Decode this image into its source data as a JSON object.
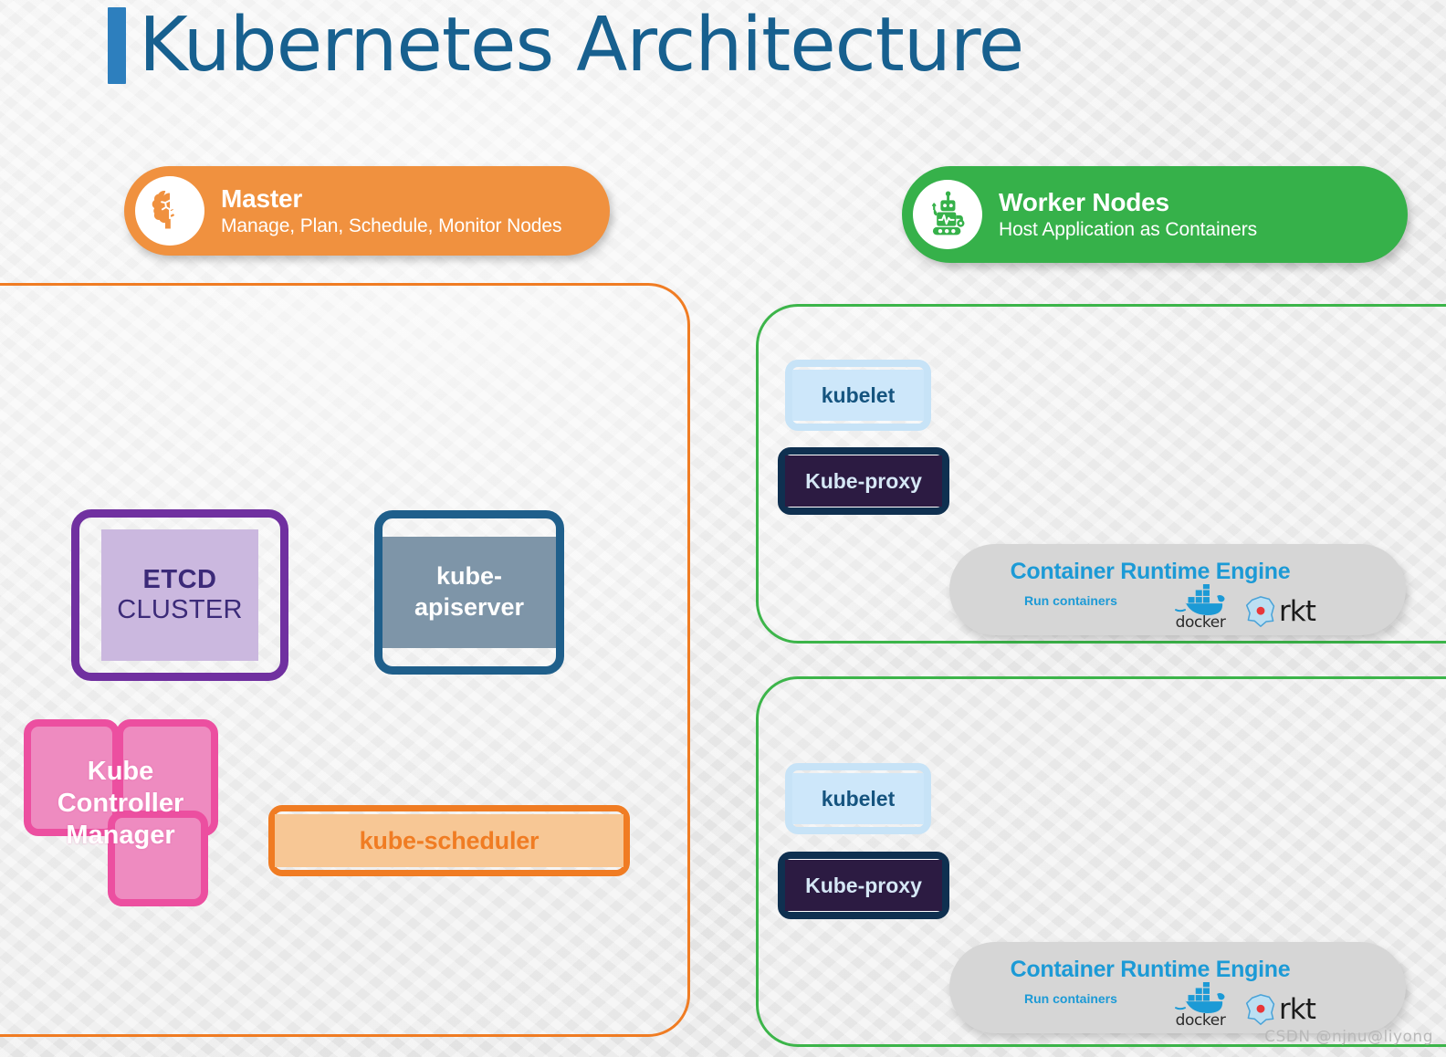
{
  "title": {
    "text": "Kubernetes Architecture",
    "accent_color": "#2d7fbe",
    "text_color": "#17608f"
  },
  "master": {
    "pill": {
      "title": "Master",
      "subtitle": "Manage, Plan, Schedule, Monitor Nodes",
      "icon": "brain-icon",
      "color": "#f0913f"
    },
    "panel_border_color": "#f07c23",
    "components": {
      "etcd": {
        "title": "ETCD",
        "subtitle": "CLUSTER",
        "border_color": "#7030a0",
        "fill_color": "#cbb8df",
        "text_color": "#3b2a78"
      },
      "apiserver": {
        "line1": "kube-",
        "line2": "apiserver",
        "border_color": "#1f5f8b",
        "fill_color": "#7e95a8",
        "text_color": "#ffffff"
      },
      "controller_manager": {
        "label": "Kube Controller Manager",
        "line1": "Kube",
        "line2": "Controller",
        "line3": "Manager",
        "border_color": "#ec4fa0",
        "fill_color": "#ee8bc0",
        "text_color": "#ffffff"
      },
      "scheduler": {
        "label": "kube-scheduler",
        "border_color": "#f07c23",
        "fill_color": "#f7c795",
        "text_color": "#f07c23"
      }
    }
  },
  "worker": {
    "pill": {
      "title": "Worker Nodes",
      "subtitle": "Host Application as Containers",
      "icon": "robot-icon",
      "color": "#36b14a"
    },
    "panel_border_color": "#3cb54a",
    "nodes": [
      {
        "kubelet": "kubelet",
        "kube_proxy": "Kube-proxy",
        "runtime": {
          "title": "Container Runtime Engine",
          "subtitle": "Run containers",
          "logos": [
            "docker",
            "rkt"
          ]
        }
      },
      {
        "kubelet": "kubelet",
        "kube_proxy": "Kube-proxy",
        "runtime": {
          "title": "Container Runtime Engine",
          "subtitle": "Run containers",
          "logos": [
            "docker",
            "rkt"
          ]
        }
      }
    ],
    "colors": {
      "kubelet_border": "#c7e3f7",
      "kubelet_fill": "#cde7fa",
      "kubelet_text": "#15547f",
      "kubeproxy_border": "#0f3050",
      "kubeproxy_fill": "#2c1b42",
      "kubeproxy_text": "#d5e7f5",
      "runtime_panel": "#d6d6d6",
      "runtime_text": "#1c9ad6"
    }
  },
  "watermark": "CSDN @njnu@liyong"
}
